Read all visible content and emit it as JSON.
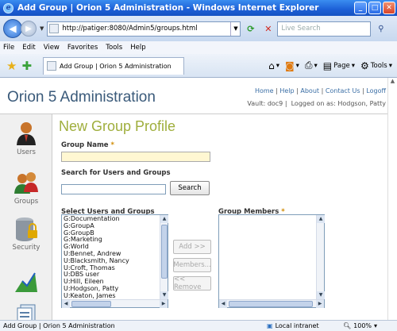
{
  "window": {
    "title": "Add Group | Orion 5 Administration - Windows Internet Explorer"
  },
  "browser": {
    "url": "http://patiger:8080/Admin5/groups.html",
    "search_placeholder": "Live Search",
    "menu": [
      "File",
      "Edit",
      "View",
      "Favorites",
      "Tools",
      "Help"
    ],
    "tab_title": "Add Group | Orion 5 Administration",
    "page_label": "Page",
    "tools_label": "Tools"
  },
  "header": {
    "app_title": "Orion 5 Administration",
    "links": [
      "Home",
      "Help",
      "About",
      "Contact Us",
      "Logoff"
    ],
    "vault_text": "Vault: doc9",
    "logged_in_text": "Logged on as: Hodgson, Patty"
  },
  "sidebar": {
    "items": [
      {
        "label": "Users",
        "icon": "user-icon"
      },
      {
        "label": "Groups",
        "icon": "group-icon"
      },
      {
        "label": "Security",
        "icon": "security-icon"
      },
      {
        "label": "",
        "icon": "chart-icon"
      },
      {
        "label": "",
        "icon": "documents-icon"
      }
    ]
  },
  "form": {
    "title": "New Group Profile",
    "group_name_label": "Group Name",
    "required_mark": "*",
    "group_name_value": "",
    "search_label": "Search for Users and Groups",
    "search_value": "",
    "search_button": "Search",
    "select_label": "Select Users and Groups",
    "select_items": [
      "G:Documentation",
      "G:GroupA",
      "G:GroupB",
      "G:Marketing",
      "G:World",
      "U:Bennet, Andrew",
      "U:Blacksmith, Nancy",
      "U:Croft, Thomas",
      "U:DBS user",
      "U:Hill, Eileen",
      "U:Hodgson, Patty",
      "U:Keaton, James"
    ],
    "members_label": "Group Members",
    "members_items": [],
    "add_button": "Add >>",
    "members_button": "Members...",
    "remove_button": "<< Remove"
  },
  "status": {
    "text": "Add Group | Orion 5 Administration",
    "zone": "Local intranet",
    "zoom": "100%"
  },
  "colors": {
    "accent": "#9fae3c",
    "title": "#3a5a7a",
    "titlebar": "#1c5fd6"
  }
}
